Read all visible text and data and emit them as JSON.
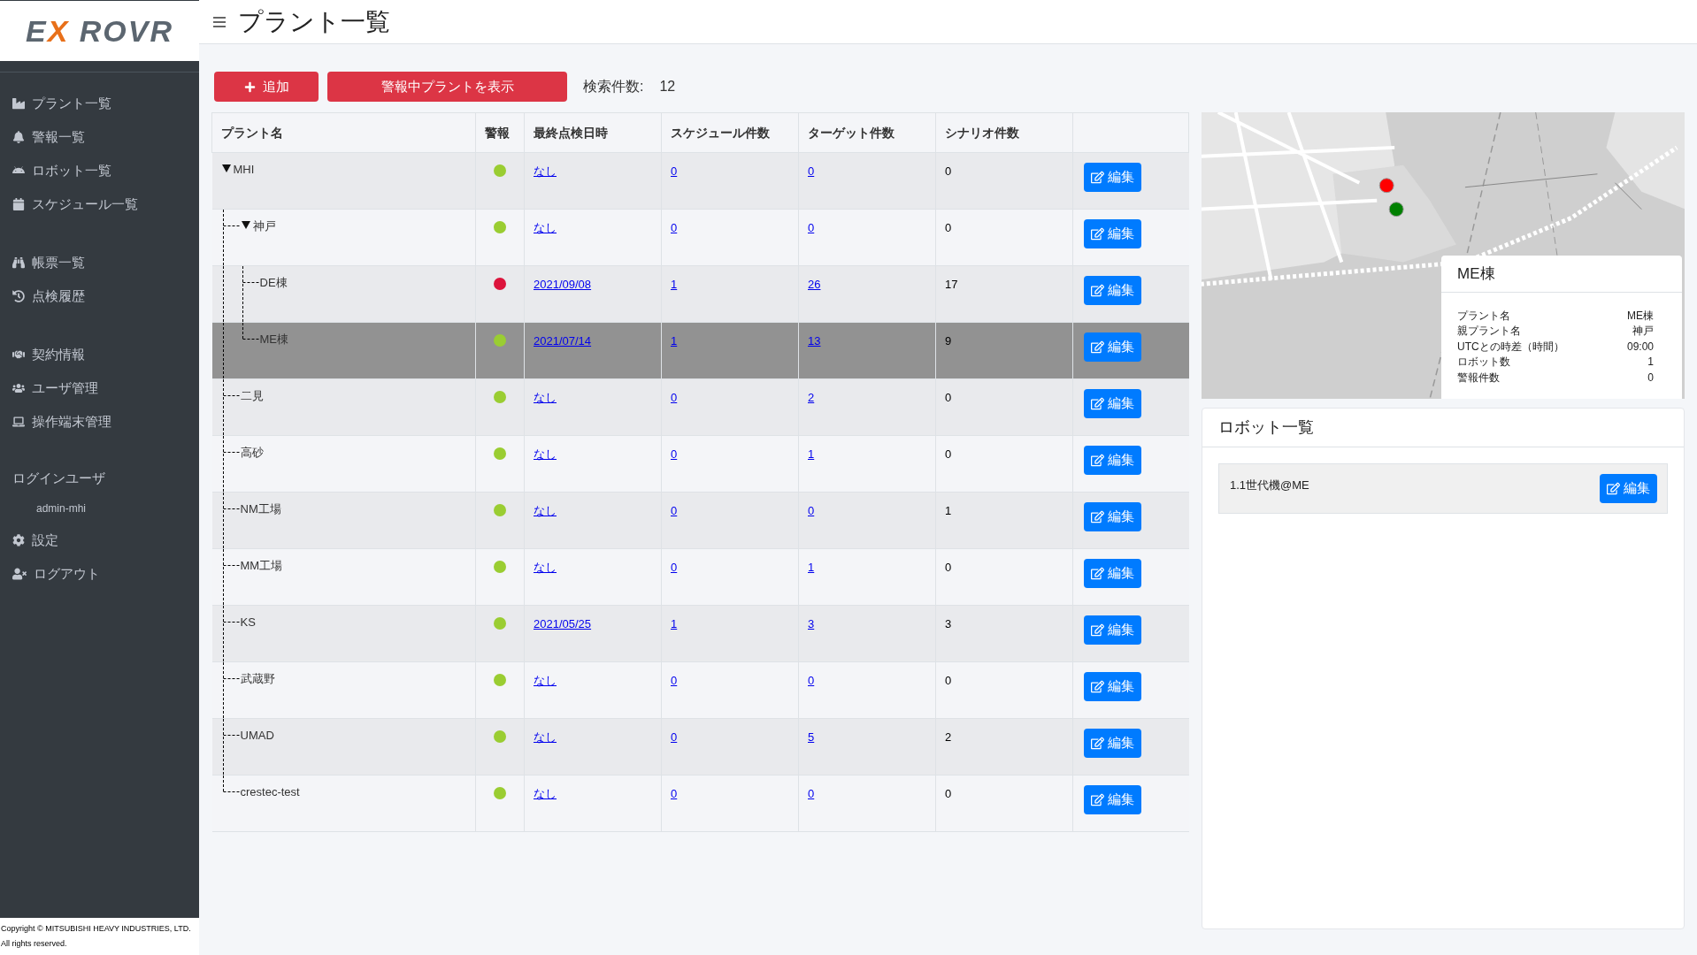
{
  "logo": [
    {
      "text": "E",
      "accent": false
    },
    {
      "text": "X",
      "accent": true
    },
    {
      "text": " ROVR",
      "accent": false
    }
  ],
  "sidebar": {
    "groups": [
      [
        "プラント一覧",
        "警報一覧",
        "ロボット一覧",
        "スケジュール一覧"
      ],
      [
        "帳票一覧",
        "点検履歴"
      ],
      [
        "契約情報",
        "ユーザ管理",
        "操作端末管理"
      ]
    ],
    "user_heading": "ログインユーザ",
    "user_name": "admin-mhi",
    "settings": "設定",
    "logout": "ログアウト",
    "copyright": [
      "Copyright © MITSUBISHI HEAVY INDUSTRIES, LTD.",
      "All rights reserved."
    ]
  },
  "page": {
    "title": "プラント一覧"
  },
  "toolbar": {
    "add_button": "追加",
    "alarm_filter_button": "警報中プラントを表示",
    "count_label": "検索件数:",
    "count": "12"
  },
  "table": {
    "columns": [
      "プラント名",
      "警報",
      "最終点検日時",
      "スケジュール件数",
      "ターゲット件数",
      "シナリオ件数"
    ],
    "rows": [
      {
        "name": "MHI",
        "expanded": true,
        "alarm": false,
        "selected": false,
        "last_inspection": "なし",
        "schedules": "0",
        "targets": "0",
        "scenarios": "0",
        "edit": "編集",
        "children": [
          {
            "name": "神戸",
            "expanded": true,
            "alarm": false,
            "selected": false,
            "last_inspection": "なし",
            "schedules": "0",
            "targets": "0",
            "scenarios": "0",
            "edit": "編集",
            "children": [
              {
                "name": "DE棟",
                "alarm": true,
                "selected": false,
                "last_inspection": "2021/09/08",
                "schedules": "1",
                "targets": "26",
                "scenarios": "17",
                "edit": "編集"
              },
              {
                "name": "ME棟",
                "alarm": false,
                "selected": true,
                "last_inspection": "2021/07/14",
                "schedules": "1",
                "targets": "13",
                "scenarios": "9",
                "edit": "編集"
              }
            ]
          },
          {
            "name": "二見",
            "alarm": false,
            "selected": false,
            "last_inspection": "なし",
            "schedules": "0",
            "targets": "2",
            "scenarios": "0",
            "edit": "編集"
          },
          {
            "name": "高砂",
            "alarm": false,
            "selected": false,
            "last_inspection": "なし",
            "schedules": "0",
            "targets": "1",
            "scenarios": "0",
            "edit": "編集"
          },
          {
            "name": "NM工場",
            "alarm": false,
            "selected": false,
            "last_inspection": "なし",
            "schedules": "0",
            "targets": "0",
            "scenarios": "1",
            "edit": "編集"
          },
          {
            "name": "MM工場",
            "alarm": false,
            "selected": false,
            "last_inspection": "なし",
            "schedules": "0",
            "targets": "1",
            "scenarios": "0",
            "edit": "編集"
          },
          {
            "name": "KS",
            "alarm": false,
            "selected": false,
            "last_inspection": "2021/05/25",
            "schedules": "1",
            "targets": "3",
            "scenarios": "3",
            "edit": "編集"
          },
          {
            "name": "武蔵野",
            "alarm": false,
            "selected": false,
            "last_inspection": "なし",
            "schedules": "0",
            "targets": "0",
            "scenarios": "0",
            "edit": "編集"
          },
          {
            "name": "UMAD",
            "alarm": false,
            "selected": false,
            "last_inspection": "なし",
            "schedules": "0",
            "targets": "5",
            "scenarios": "2",
            "edit": "編集"
          },
          {
            "name": "crestec-test",
            "alarm": false,
            "selected": false,
            "last_inspection": "なし",
            "schedules": "0",
            "targets": "0",
            "scenarios": "0",
            "edit": "編集"
          }
        ]
      }
    ]
  },
  "map": {
    "kind": "picture",
    "popup": {
      "title": "ME棟",
      "rows": [
        {
          "label": "プラント名",
          "value": "ME棟"
        },
        {
          "label": "親プラント名",
          "value": "神戸"
        },
        {
          "label": "UTCとの時差（時間）",
          "value": "09:00"
        },
        {
          "label": "ロボット数",
          "value": "1"
        },
        {
          "label": "警報件数",
          "value": "0"
        }
      ]
    }
  },
  "robots": {
    "title": "ロボット一覧",
    "items": [
      {
        "name": "1.1世代機@ME",
        "edit": "編集"
      }
    ]
  }
}
